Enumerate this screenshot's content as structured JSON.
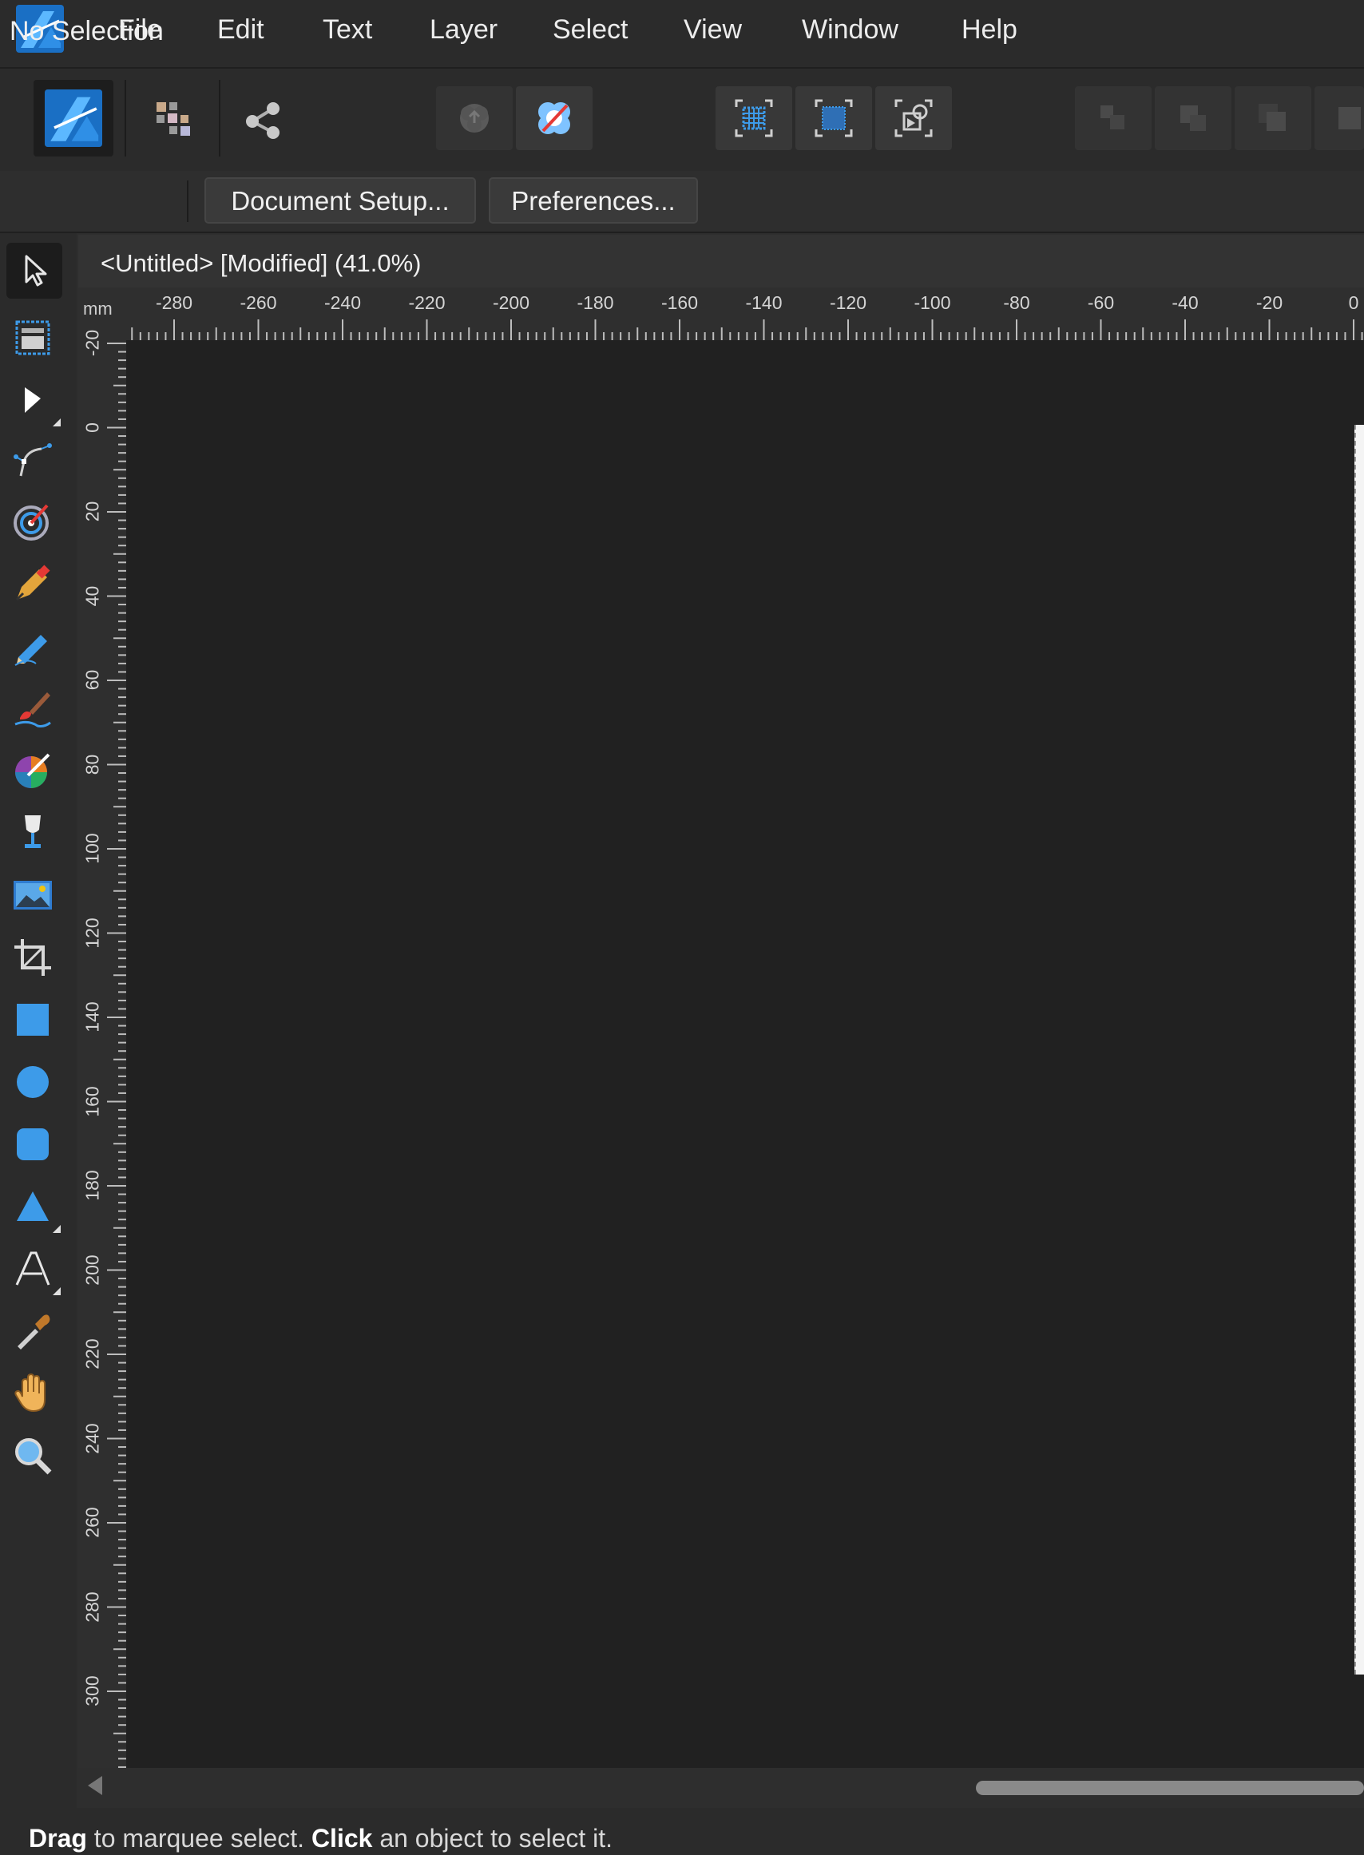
{
  "menu": {
    "items": [
      "File",
      "Edit",
      "Text",
      "Layer",
      "Select",
      "View",
      "Window",
      "Help"
    ]
  },
  "toolbar": {
    "icons": [
      "affinity-designer-persona-icon",
      "pixel-persona-icon",
      "export-persona-icon",
      "place-icon",
      "toggle-snapping-icon",
      "select-all-icon",
      "deselect-icon",
      "transform-origin-icon",
      "arrange-back-icon",
      "arrange-backward-icon",
      "arrange-forward-icon",
      "arrange-front-icon"
    ]
  },
  "context": {
    "selection_label": "No Selection",
    "document_setup_label": "Document Setup...",
    "preferences_label": "Preferences..."
  },
  "document": {
    "tab_title": "<Untitled> [Modified] (41.0%)"
  },
  "rulers": {
    "unit": "mm",
    "horizontal_labels": [
      "-280",
      "-260",
      "-240",
      "-220",
      "-200",
      "-180",
      "-160",
      "-140",
      "-120",
      "-100",
      "-80",
      "-60",
      "-40",
      "-20",
      "0"
    ],
    "vertical_labels": [
      "-20",
      "0",
      "20",
      "40",
      "60",
      "80",
      "100",
      "120",
      "140",
      "160",
      "180",
      "200",
      "220",
      "240",
      "260",
      "280",
      "300"
    ]
  },
  "tools": [
    "move-tool-icon",
    "artboard-tool-icon",
    "node-tool-icon",
    "corner-tool-icon",
    "point-transform-tool-icon",
    "pen-tool-icon",
    "pencil-tool-icon",
    "vector-brush-tool-icon",
    "fill-tool-icon",
    "transparency-tool-icon",
    "place-image-tool-icon",
    "vector-crop-tool-icon",
    "rectangle-tool-icon",
    "ellipse-tool-icon",
    "rounded-rectangle-tool-icon",
    "triangle-tool-icon",
    "artistic-text-tool-icon",
    "color-picker-tool-icon",
    "view-tool-icon",
    "zoom-tool-icon"
  ],
  "status": {
    "drag_word": "Drag",
    "drag_text": " to marquee select. ",
    "click_word": "Click",
    "click_text": " an object to select it."
  },
  "colors": {
    "accent": "#3d9be9",
    "canvas": "#212121",
    "panel": "#2b2b2b"
  }
}
